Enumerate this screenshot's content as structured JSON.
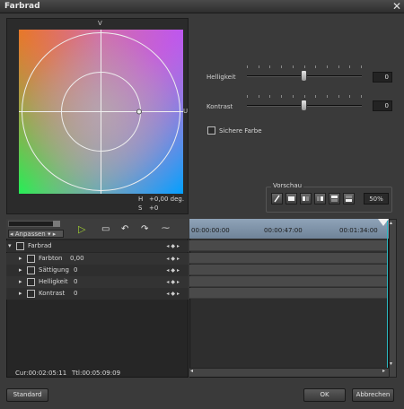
{
  "window": {
    "title": "Farbrad",
    "close_glyph": "✕"
  },
  "wheel": {
    "axis_v": "V",
    "axis_u": "U",
    "hue_label": "H",
    "hue_value": "+0,00 deg.",
    "sat_label": "S",
    "sat_value": "+0"
  },
  "sliders": [
    {
      "label": "Helligkeit",
      "value": "0",
      "fraction": 0.5
    },
    {
      "label": "Kontrast",
      "value": "0",
      "fraction": 0.5
    }
  ],
  "safe_color": {
    "label": "Sichere Farbe",
    "checked": false
  },
  "preview": {
    "label": "Vorschau",
    "buttons": [
      "pen-icon",
      "full-icon",
      "split-left-icon",
      "split-right-icon",
      "split-top-icon",
      "split-bottom-icon"
    ],
    "zoom": "50%"
  },
  "toolbar": {
    "adjust_label": "Anpassen",
    "icons": [
      "play-icon",
      "comment-icon",
      "undo-icon",
      "redo-icon",
      "graph-icon"
    ]
  },
  "tree": {
    "root": "Farbrad",
    "items": [
      {
        "label": "Farbton",
        "value": "0,00"
      },
      {
        "label": "Sättigung",
        "value": "0"
      },
      {
        "label": "Helligkeit",
        "value": "0"
      },
      {
        "label": "Kontrast",
        "value": "0"
      }
    ]
  },
  "status": {
    "cur": "Cur:00:02:05:11",
    "ttl": "Ttl:00:05:09:09"
  },
  "timeline": {
    "ticks": [
      "00:00:00:00",
      "00:00:47:00",
      "00:01:34:00"
    ]
  },
  "buttons": {
    "standard": "Standard",
    "ok": "OK",
    "cancel": "Abbrechen"
  },
  "colors": {
    "accent": "#9acd32",
    "playhead": "#2bb8c0",
    "ruler": "#7f93a8"
  }
}
